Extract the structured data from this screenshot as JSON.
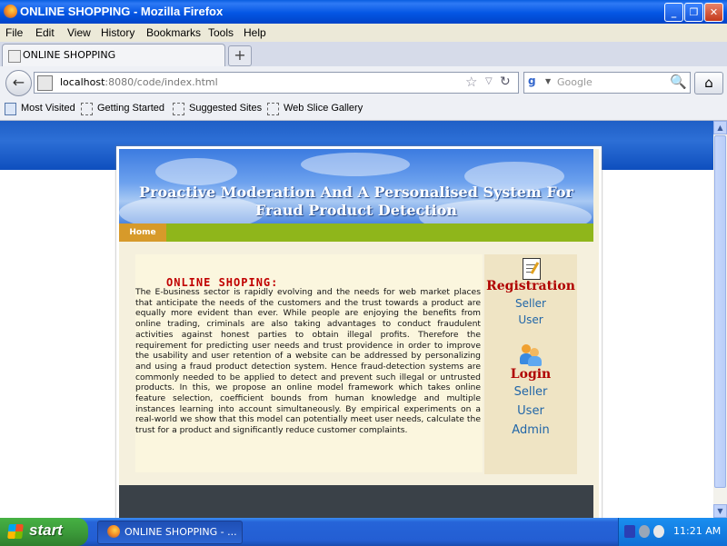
{
  "window": {
    "title": "ONLINE SHOPPING - Mozilla Firefox",
    "minimize": "_",
    "restore": "❐",
    "close": "✕"
  },
  "menu": [
    "File",
    "Edit",
    "View",
    "History",
    "Bookmarks",
    "Tools",
    "Help"
  ],
  "tab": {
    "title": "ONLINE SHOPPING",
    "new_tab": "+"
  },
  "nav": {
    "back": "←",
    "url_host": "localhost",
    "url_rest": ":8080/code/index.html",
    "search_placeholder": "Google",
    "search_engine_letter": "g",
    "home": "⌂",
    "star": "☆",
    "dropdown": "▽",
    "reload": "↻",
    "magnifier": "🔍"
  },
  "bookmarks": [
    "Most Visited",
    "Getting Started",
    "Suggested Sites",
    "Web Slice Gallery"
  ],
  "site": {
    "banner_title_line1": "Proactive Moderation And A Personalised System For",
    "banner_title_line2": "Fraud Product Detection",
    "nav_home": "Home",
    "heading": "ONLINE SHOPING:",
    "body": "The E-business sector is rapidly evolving and the needs for web market places that anticipate the needs of the customers and the trust towards a product are equally more evident than ever. While people are enjoying the benefits from online trading, criminals are also taking advantages to conduct fraudulent activities against honest parties to obtain illegal profits. Therefore the requirement for predicting user needs and trust providence in order to improve the usability and user retention of a website can be addressed by personalizing and using a fraud product detection system. Hence fraud-detection systems are commonly needed to be applied to detect and prevent such illegal or untrusted products. In this, we propose an online model framework which takes online feature selection, coefficient bounds from human knowledge and multiple instances learning into account simultaneously. By empirical experiments on a real-world we show that this model can potentially meet user needs, calculate the trust for a product and significantly reduce customer complaints.",
    "sidebar": {
      "registration_heading": "Registration",
      "registration_links": [
        "Seller",
        "User"
      ],
      "login_heading": "Login",
      "login_links": [
        "Seller",
        "User",
        "Admin"
      ]
    }
  },
  "taskbar": {
    "start": "start",
    "task_label": "ONLINE SHOPPING - ...",
    "clock": "11:21 AM"
  }
}
